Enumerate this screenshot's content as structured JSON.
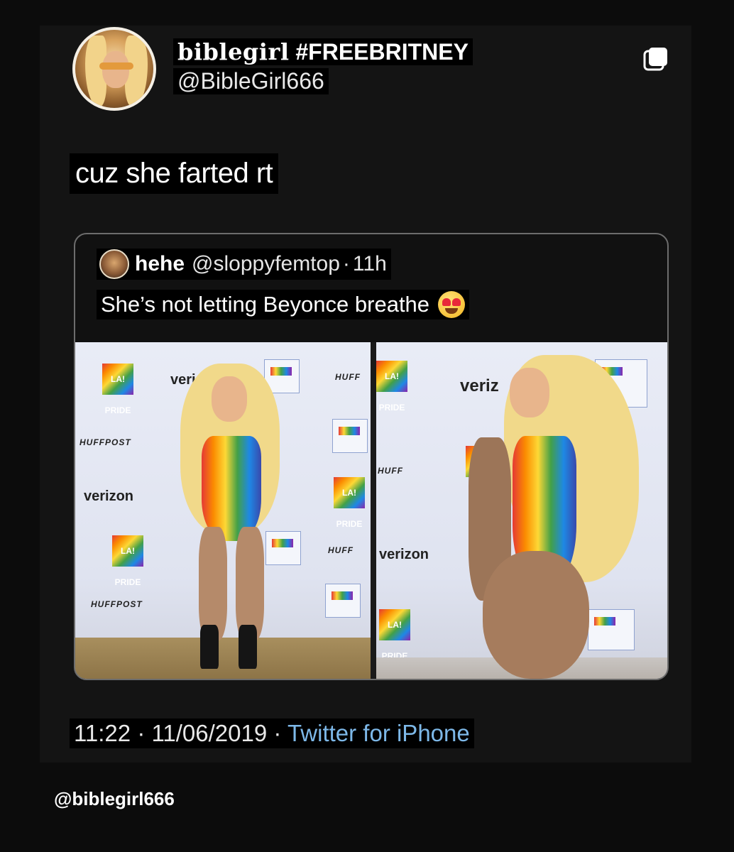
{
  "author": {
    "display_name": "biblegirl",
    "display_hashtag": "#FREEBRITNEY",
    "handle": "@BibleGirl666"
  },
  "tweet": {
    "text": "cuz she farted rt",
    "time": "11:22",
    "date": "11/06/2019",
    "separator": "·",
    "source": "Twitter for iPhone"
  },
  "quoted_tweet": {
    "name": "hehe",
    "handle": "@sloppyfemtop",
    "separator": "·",
    "time": "11h",
    "text": "She’s not letting Beyonce breathe",
    "emoji": "heart-eyes-emoji"
  },
  "photo_backdrop": {
    "brand_1": "verizon",
    "brand_1_short": "veri",
    "brand_1_alt": "veriz",
    "brand_2": "HUFFPOST",
    "brand_2_short": "HUFF",
    "pride": "LA! PRIDE"
  },
  "watermark": "@biblegirl666",
  "icons": {
    "copy": "copy-icon",
    "emoji": "heart-eyes-emoji"
  },
  "colors": {
    "background": "#0c0c0c",
    "card": "#141414",
    "link": "#7db8e8",
    "text": "#ffffff"
  }
}
